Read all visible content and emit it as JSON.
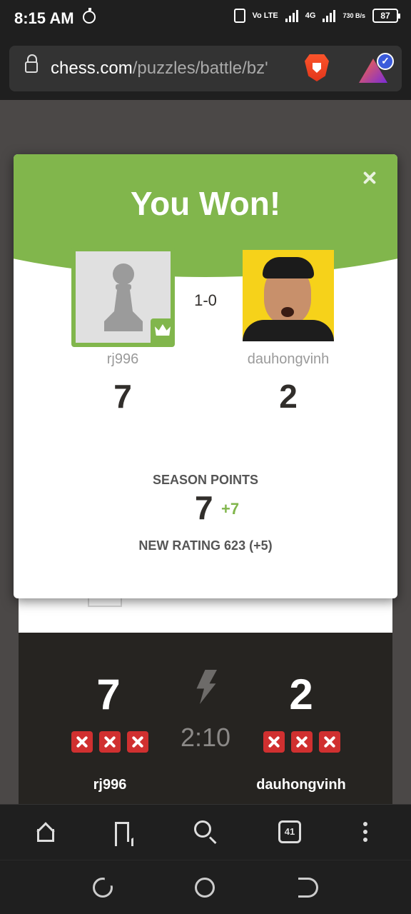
{
  "status_bar": {
    "time": "8:15 AM",
    "volte": "Vo LTE",
    "network": "4G",
    "speed": "730 B/s",
    "battery": "87"
  },
  "browser": {
    "url_domain": "chess.com",
    "url_path": "/puzzles/battle/bz'"
  },
  "modal": {
    "title": "You Won!",
    "result": "1-0",
    "player_left": {
      "name": "rj996",
      "score": "7"
    },
    "player_right": {
      "name": "dauhongvinh",
      "score": "2"
    },
    "season_label": "SEASON POINTS",
    "season_points": "7",
    "season_delta": "+7",
    "new_rating": "NEW RATING 623 (+5)"
  },
  "battle": {
    "left_score": "7",
    "right_score": "2",
    "timer": "2:10",
    "left_name": "rj996",
    "right_name": "dauhongvinh",
    "left_misses": 3,
    "right_misses": 3
  },
  "toolbar": {
    "tab_count": "41"
  },
  "colors": {
    "accent_green": "#81b64c",
    "miss_red": "#d03030",
    "dark_bg": "#312e2b"
  }
}
